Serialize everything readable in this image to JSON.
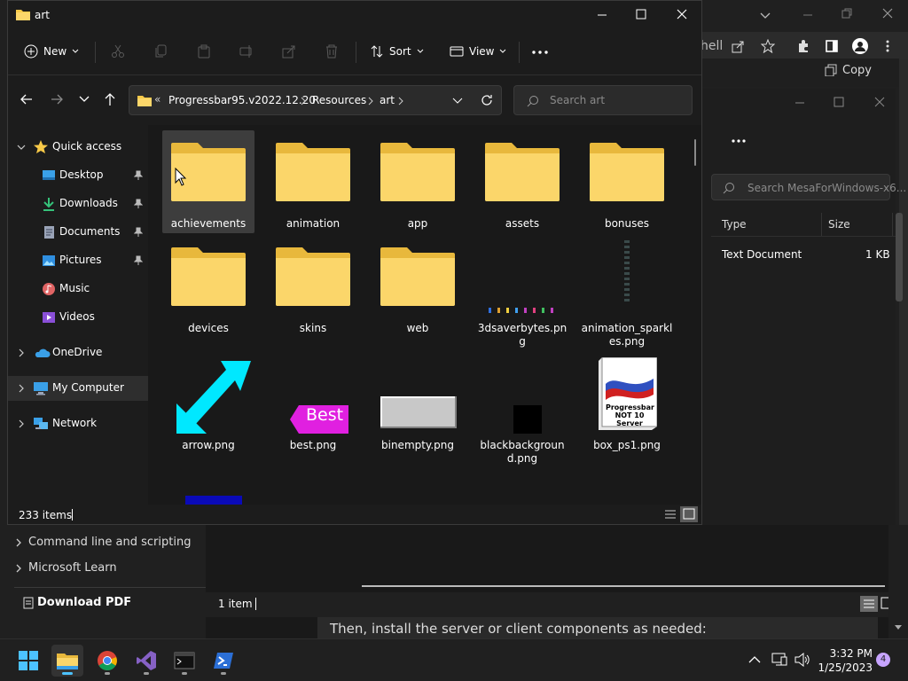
{
  "explorer": {
    "title": "art",
    "toolbar": {
      "new_label": "New",
      "sort_label": "Sort",
      "view_label": "View"
    },
    "address": {
      "prefix": "«",
      "crumbs": [
        "Progressbar95.v2022.12.20",
        "Resources",
        "art"
      ]
    },
    "search": {
      "placeholder": "Search art"
    },
    "nav": {
      "quick_access": "Quick access",
      "quick_items": [
        {
          "label": "Desktop",
          "icon": "desktop-icon"
        },
        {
          "label": "Downloads",
          "icon": "download-icon"
        },
        {
          "label": "Documents",
          "icon": "documents-icon"
        },
        {
          "label": "Pictures",
          "icon": "pictures-icon"
        },
        {
          "label": "Music",
          "icon": "music-icon"
        },
        {
          "label": "Videos",
          "icon": "videos-icon"
        }
      ],
      "onedrive": "OneDrive",
      "my_computer": "My Computer",
      "network": "Network"
    },
    "items": [
      {
        "label": "achievements",
        "kind": "folder"
      },
      {
        "label": "animation",
        "kind": "folder"
      },
      {
        "label": "app",
        "kind": "folder"
      },
      {
        "label": "assets",
        "kind": "folder"
      },
      {
        "label": "bonuses",
        "kind": "folder"
      },
      {
        "label": "devices",
        "kind": "folder"
      },
      {
        "label": "skins",
        "kind": "folder"
      },
      {
        "label": "web",
        "kind": "folder"
      },
      {
        "label": "3dsaverbytes.png",
        "kind": "image"
      },
      {
        "label": "animation_sparkles.png",
        "kind": "image"
      },
      {
        "label": "arrow.png",
        "kind": "image"
      },
      {
        "label": "best.png",
        "kind": "image",
        "text": "Best"
      },
      {
        "label": "binempty.png",
        "kind": "image"
      },
      {
        "label": "blackbackground.png",
        "kind": "image"
      },
      {
        "label": "box_ps1.png",
        "kind": "image",
        "text": "Progressbar NOT 10 Server"
      }
    ],
    "status": {
      "count": "233 items"
    }
  },
  "background": {
    "browser": {
      "tab_text": "hell",
      "copy_label": "Copy"
    },
    "explorer2": {
      "search_placeholder": "Search MesaForWindows-x6...",
      "col_type": "Type",
      "col_size": "Size",
      "row_type": "Text Document",
      "row_size": "1 KB",
      "status": "1 item"
    },
    "doc": {
      "link1": "Command line and scripting",
      "link2": "Microsoft Learn",
      "download_pdf": "Download PDF",
      "body_text": "Then, install the server or client components as needed:"
    }
  },
  "taskbar": {
    "time": "3:32 PM",
    "date": "1/25/2023",
    "notification_count": "4"
  },
  "colors": {
    "folder": "#f7c948",
    "accent": "#4cc2ff",
    "badge": "#c7a4ff"
  }
}
